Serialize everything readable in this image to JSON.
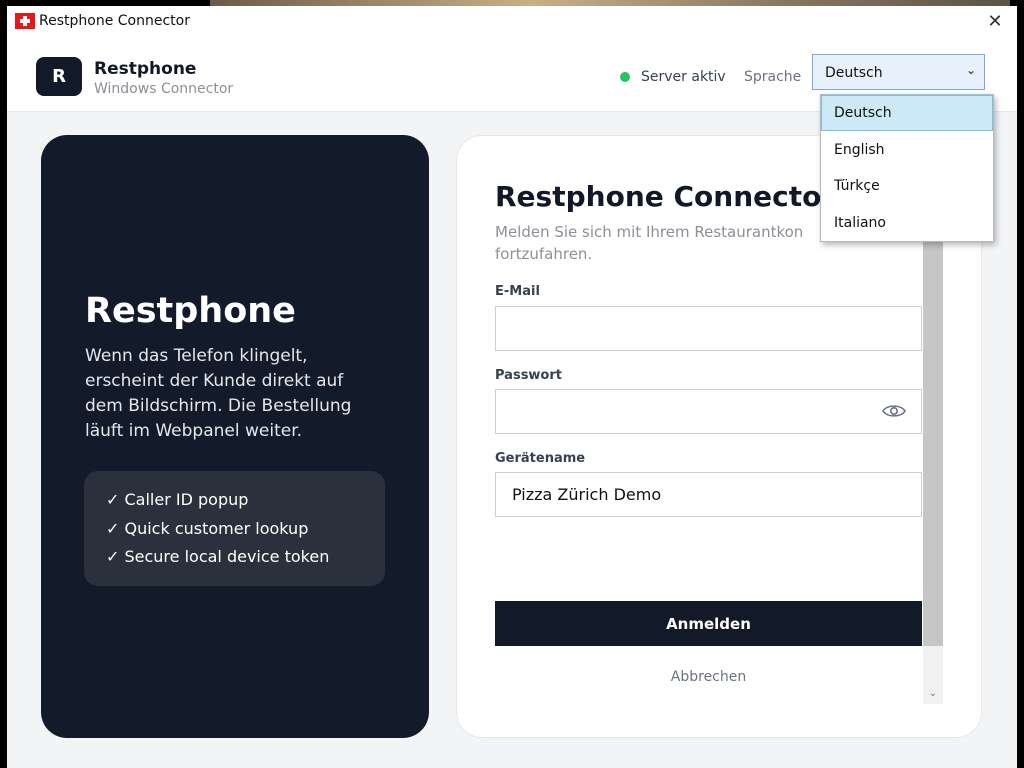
{
  "window": {
    "title": "Restphone Connector",
    "close_icon": "close-icon",
    "app_icon": "swiss-flag-icon"
  },
  "header": {
    "logo_letter": "R",
    "brand_name": "Restphone",
    "brand_subtitle": "Windows Connector",
    "status_text": "Server aktiv",
    "status_color": "#22c55e",
    "language_label": "Sprache",
    "language_selected": "Deutsch",
    "language_options": [
      "Deutsch",
      "English",
      "Türkçe",
      "Italiano"
    ]
  },
  "left_panel": {
    "title": "Restphone",
    "description": "Wenn das Telefon klingelt, erscheint der Kunde direkt auf dem Bildschirm. Die Bestellung läuft im Webpanel weiter.",
    "features": [
      "✓ Caller ID popup",
      "✓ Quick customer lookup",
      "✓ Secure local device token"
    ]
  },
  "login_card": {
    "title": "Restphone Connector",
    "subtitle_visible": "Melden Sie sich mit Ihrem Restaurantkon",
    "subtitle_line2": "fortzufahren.",
    "email_label": "E-Mail",
    "email_value": "",
    "password_label": "Passwort",
    "password_value": "",
    "device_label": "Gerätename",
    "device_value": "Pizza Zürich Demo",
    "login_button": "Anmelden",
    "cancel_link": "Abbrechen"
  },
  "colors": {
    "dark_navy": "#131a29",
    "feature_box": "#2a303c",
    "page_bg": "#f3f4f6"
  }
}
